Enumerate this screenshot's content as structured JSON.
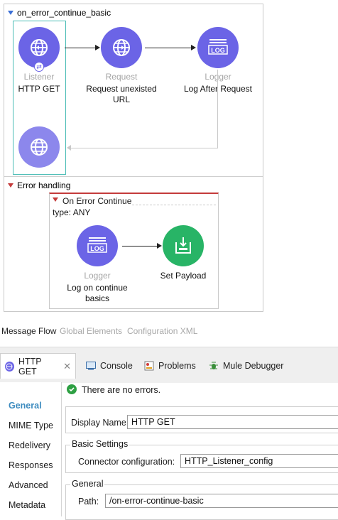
{
  "flow": {
    "name": "on_error_continue_basic",
    "nodes": [
      {
        "type": "Listener",
        "name": "HTTP GET"
      },
      {
        "type": "Request",
        "name": "Request unexisted URL"
      },
      {
        "type": "Logger",
        "name": "Log After Request"
      }
    ],
    "logger_icon_text": "LOG",
    "error_handling": {
      "title": "Error handling",
      "scope_title": "On Error Continue",
      "scope_type": "type: ANY",
      "nodes": [
        {
          "type": "Logger",
          "name": "Log on continue basics"
        },
        {
          "type": "",
          "name": "Set Payload"
        }
      ]
    }
  },
  "editor_tabs": [
    "Message Flow",
    "Global Elements",
    "Configuration XML"
  ],
  "panel": {
    "tabs": [
      {
        "label": "HTTP GET",
        "icon": "globe-icon"
      },
      {
        "label": "Console",
        "icon": "console-icon"
      },
      {
        "label": "Problems",
        "icon": "problems-icon"
      },
      {
        "label": "Mule Debugger",
        "icon": "debugger-icon"
      }
    ],
    "status": "There are no errors.",
    "nav": [
      "General",
      "MIME Type",
      "Redelivery",
      "Responses",
      "Advanced",
      "Metadata"
    ],
    "display_name_label": "Display Name:",
    "display_name_value": "HTTP GET",
    "basic_settings": "Basic Settings",
    "connector_label": "Connector configuration:",
    "connector_value": "HTTP_Listener_config",
    "general_group": "General",
    "path_label": "Path:",
    "path_value": "/on-error-continue-basic"
  },
  "colors": {
    "node_purple": "#6b64e6",
    "node_green": "#28b466",
    "error_red": "#c43b3b",
    "source_teal": "#4bbdb6",
    "nav_active": "#3c8bbf"
  }
}
